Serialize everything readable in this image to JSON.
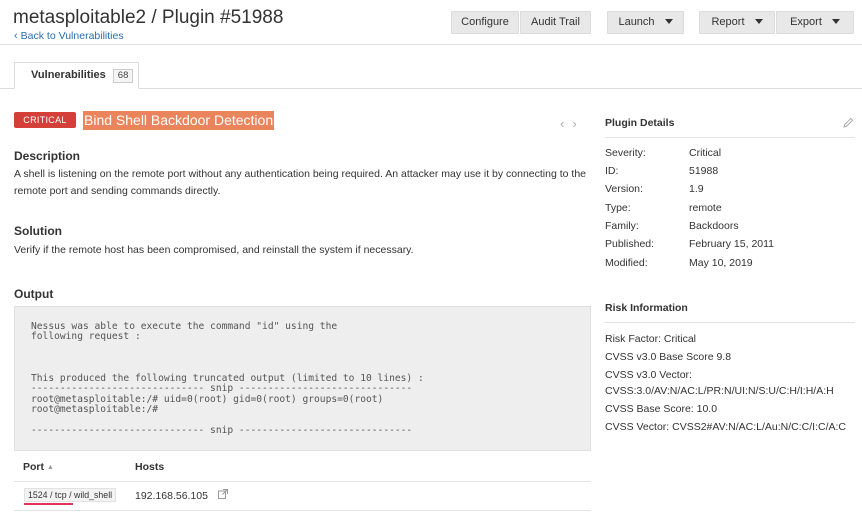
{
  "header": {
    "title": "metasploitable2 / Plugin #51988",
    "back_link": "Back to Vulnerabilities",
    "buttons": {
      "configure": "Configure",
      "audit_trail": "Audit Trail",
      "launch": "Launch",
      "report": "Report",
      "export": "Export"
    }
  },
  "tabs": [
    {
      "label": "Vulnerabilities",
      "count": "68"
    }
  ],
  "plugin": {
    "severity_badge": "CRITICAL",
    "name": "Bind Shell Backdoor Detection",
    "nav_prev": "‹",
    "nav_next": "›"
  },
  "description": {
    "title": "Description",
    "text": "A shell is listening on the remote port without any authentication being required. An attacker may use it by connecting to the remote port and sending commands directly."
  },
  "solution": {
    "title": "Solution",
    "text": "Verify if the remote host has been compromised, and reinstall the system if necessary."
  },
  "output": {
    "title": "Output",
    "text": "Nessus was able to execute the command \"id\" using the\nfollowing request :\n\n\n\nThis produced the following truncated output (limited to 10 lines) :\n------------------------------ snip ------------------------------\nroot@metasploitable:/# uid=0(root) gid=0(root) groups=0(root)\nroot@metasploitable:/#\n\n------------------------------ snip ------------------------------"
  },
  "ports_table": {
    "headers": {
      "port": "Port",
      "hosts": "Hosts"
    },
    "sort_indicator": "▲",
    "rows": [
      {
        "port": "1524 / tcp / wild_shell",
        "host": "192.168.56.105"
      }
    ]
  },
  "plugin_details": {
    "title": "Plugin Details",
    "items": [
      {
        "label": "Severity:",
        "value": "Critical"
      },
      {
        "label": "ID:",
        "value": "51988"
      },
      {
        "label": "Version:",
        "value": "1.9"
      },
      {
        "label": "Type:",
        "value": "remote"
      },
      {
        "label": "Family:",
        "value": "Backdoors"
      },
      {
        "label": "Published:",
        "value": "February 15, 2011"
      },
      {
        "label": "Modified:",
        "value": "May 10, 2019"
      }
    ]
  },
  "risk_information": {
    "title": "Risk Information",
    "items": [
      "Risk Factor: Critical",
      "CVSS v3.0 Base Score 9.8",
      "CVSS v3.0 Vector: CVSS:3.0/AV:N/AC:L/PR:N/UI:N/S:U/C:H/I:H/A:H",
      "CVSS Base Score: 10.0",
      "CVSS Vector: CVSS2#AV:N/AC:L/Au:N/C:C/I:C/A:C"
    ]
  },
  "colors": {
    "critical": "#d43f3a",
    "highlight": "#e9845c",
    "link": "#2a6db0",
    "underline_mark": "#e8305d"
  },
  "icons": {
    "back": "chevron-left-icon",
    "external_link": "external-link-icon",
    "edit": "pencil-icon"
  }
}
